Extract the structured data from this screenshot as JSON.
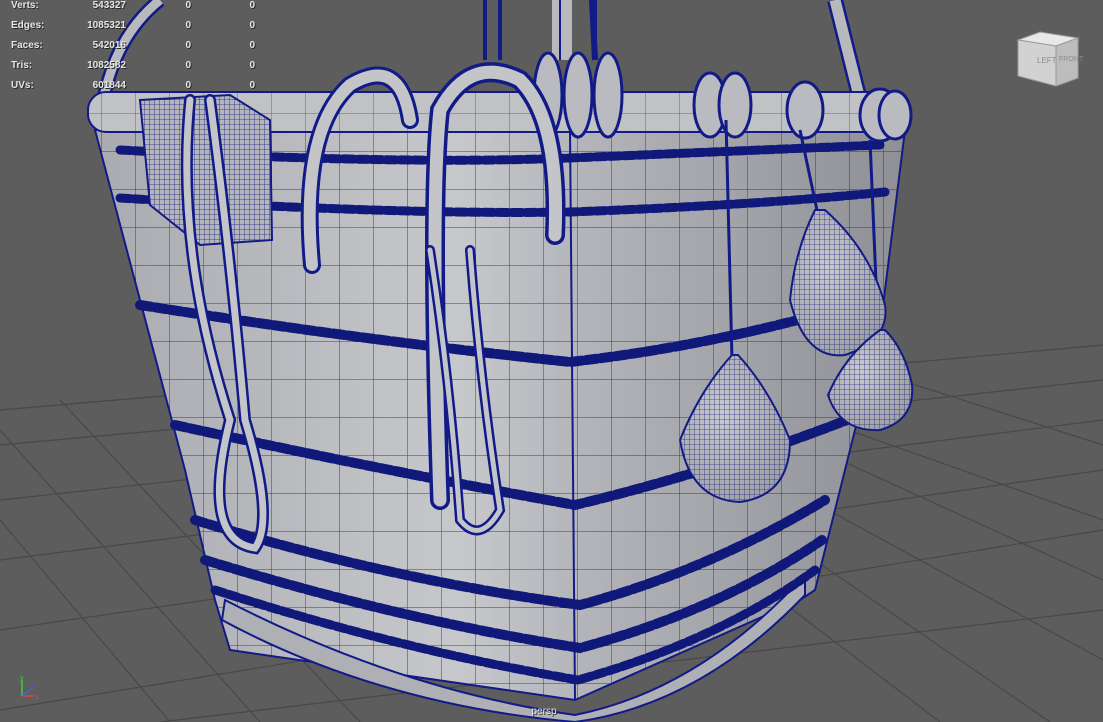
{
  "hud": {
    "rows": [
      {
        "label": "Verts:",
        "value": "543327",
        "selected": "0",
        "components": "0"
      },
      {
        "label": "Edges:",
        "value": "1085321",
        "selected": "0",
        "components": "0"
      },
      {
        "label": "Faces:",
        "value": "542016",
        "selected": "0",
        "components": "0"
      },
      {
        "label": "Tris:",
        "value": "1082582",
        "selected": "0",
        "components": "0"
      },
      {
        "label": "UVs:",
        "value": "601844",
        "selected": "0",
        "components": "0"
      }
    ]
  },
  "viewcube": {
    "left_face": "LEFT",
    "front_face": "FRONT"
  },
  "camera": {
    "name": "persp"
  },
  "axis": {
    "x": "x",
    "y": "y",
    "z": "z"
  },
  "colors": {
    "background": "#5d5d5d",
    "grid": "#484848",
    "wireframe": "#111a86",
    "surface": "#b9bbc0",
    "hud_text": "#e6e6e6"
  }
}
